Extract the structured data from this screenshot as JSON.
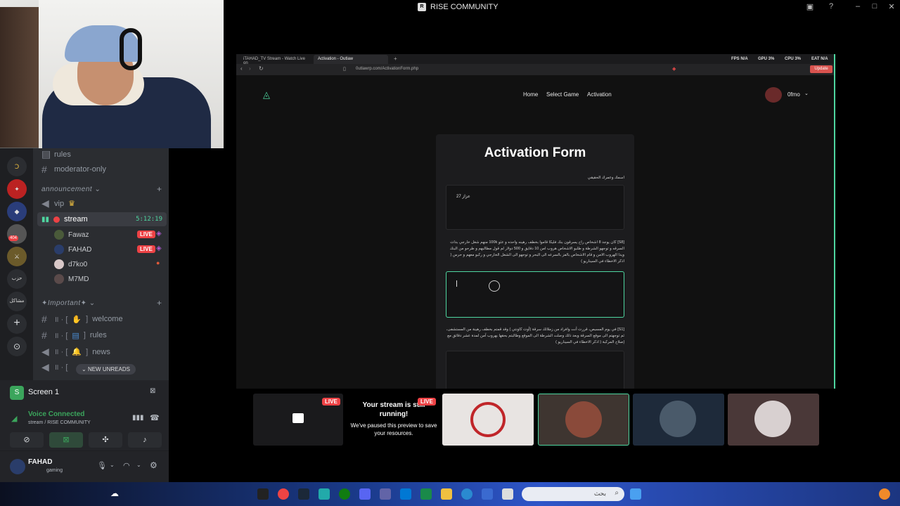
{
  "app": {
    "title": "RISE COMMUNITY"
  },
  "discord": {
    "channels_top": [
      {
        "label": "rules"
      },
      {
        "label": "moderator-only"
      }
    ],
    "category_announcement": "announcement",
    "vip_label": "vip",
    "stream_channel": {
      "label": "stream",
      "timer": "5:12:19"
    },
    "members": [
      {
        "name": "Fawaz",
        "live": "LIVE"
      },
      {
        "name": "FAHAD",
        "live": "LIVE"
      },
      {
        "name": "d7ko0",
        "live": ""
      },
      {
        "name": "M7MD",
        "live": ""
      }
    ],
    "category_important": "✦Important✦",
    "important_channels": [
      {
        "label": "welcome"
      },
      {
        "label": "rules"
      },
      {
        "label": "news"
      }
    ],
    "new_unreads": "NEW UNREADS",
    "guild_labels": {
      "badge": "404",
      "text1": "حزب",
      "text2": "مشاكل"
    },
    "screen_share": {
      "title": "Screen 1"
    },
    "voice": {
      "status": "Voice Connected",
      "location": "stream / RISE COMMUNITY"
    },
    "user": {
      "name": "FAHAD",
      "status": "gaming"
    }
  },
  "browser": {
    "tabs": [
      {
        "label": "iTAHAD_TV Stream - Watch Live on"
      },
      {
        "label": "Activation - Outlaw"
      }
    ],
    "url": "0utlawrp.com/ActivationForm.php",
    "stats": {
      "fps": "FPS N/A",
      "gpu": "GPU 3%",
      "cpu": "CPU 3%",
      "eat": "EAT N/A"
    },
    "update_label": "Update"
  },
  "site": {
    "nav": {
      "home": "Home",
      "select_game": "Select Game",
      "activation": "Activation",
      "user": "0fmo"
    },
    "form": {
      "title": "Activation Form",
      "q1": "اسمك وعمرك الحقيقي",
      "q1_value": "عزاز 27",
      "q2": "[S8] كان يوجد 8 اشخاص راح يسرقون بنك فليكا قاموا بخطف رهينه واحده و عثو 100k منهم شغل خارجي بدات السرقه و توجهو الشرطة و طلبو الاشخاص هروب امن 10 دقايق و 500 دولار لم قول مطالبهم و طرحو من البنك ويدا الهروب الامن و قام الاشخاص بالفز بالسرعه الى البحر و توجهو الى الشغل الخارجي و ركبو معهم و حرس ( اذكر الاخطاء في السيناريو )",
      "q3": "[S1] في يوم المسبص، قررت أنت وافراد من زملائك سرقة (أوت كاونتي ) وقد قمتم بخطف رهينة من المستشفى، ثم توجهتم الى موقع السرقة وبعد ذلك وصلت الشرطة الى الموقع وطالبتم بحقها بهروب آمن لمدة عشر دقائق مع إصلاح المركبة ( اذكر الاخطاء في السيناريو )"
    }
  },
  "stream_tiles": {
    "live_label": "LIVE",
    "paused_title": "Your stream is still running!",
    "paused_sub": "We've paused this preview to save your resources."
  },
  "taskbar": {
    "search_placeholder": "بحث"
  }
}
